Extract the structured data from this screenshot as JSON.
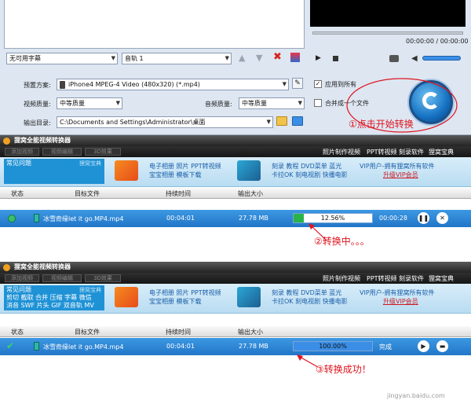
{
  "top_panel": {
    "subtitle_select": "无可用字幕",
    "audio_select": "音轨 1",
    "time_display": "00:00:00 / 00:00:00",
    "preset_label": "预置方案:",
    "preset_value": "iPhone4 MPEG-4 Video (480x320) (*.mp4)",
    "apply_all_label": "应用到所有",
    "apply_all_checked": true,
    "video_quality_label": "视频质量:",
    "video_quality_value": "中等质量",
    "audio_quality_label": "音频质量:",
    "audio_quality_value": "中等质量",
    "merge_label": "合并成一个文件",
    "merge_checked": false,
    "output_label": "输出目录:",
    "output_path": "C:\\Documents and Settings\\Administrator\\桌面",
    "annotation_1": "①点击开始转换"
  },
  "windows": [
    {
      "title": "狸窝全能视频转换器",
      "toolbar_buttons": [
        "添加视频",
        "视频编辑",
        "3D效果"
      ],
      "nav_links": [
        "照片制作视频",
        "PPT转视频",
        "刻录软件",
        "狸窝宝典"
      ],
      "faq_title": "常见问题",
      "faq_subtitle": "狸窝宝典",
      "faq_lines": [
        "",
        ""
      ],
      "ad_block_1": [
        "电子相册 照片 PPT转视频",
        "宝宝相册 模板下载"
      ],
      "ad_block_2": [
        "刻录 教程 DVD菜单 蓝光",
        "卡拉OK 刻电视剧 快播电影"
      ],
      "ad_block_3": [
        "VIP用户-拥有狸窝所有软件",
        "升级VIP会员"
      ],
      "headers": [
        "状态",
        "目标文件",
        "持续时间",
        "输出大小"
      ],
      "file_name": "冰雪奇缘let it go.MP4.mp4",
      "duration": "00:04:01",
      "size": "27.78 MB",
      "progress_text": "12.56%",
      "progress": 0.1256,
      "remaining": "00:00:28",
      "annotation": "②转换中。。。"
    },
    {
      "title": "狸窝全能视频转换器",
      "toolbar_buttons": [
        "添加视频",
        "视频编辑",
        "3D效果"
      ],
      "nav_links": [
        "照片制作视频",
        "PPT转视频",
        "刻录软件",
        "狸窝宝典"
      ],
      "faq_title": "常见问题",
      "faq_subtitle": "狸窝宝典",
      "faq_lines": [
        "剪切 截取 合并 压缩 字幕 微信",
        "消音 SWF 片头 GIF 双音轨 MV"
      ],
      "ad_block_1": [
        "电子相册 照片 PPT转视频",
        "宝宝相册 模板下载"
      ],
      "ad_block_2": [
        "刻录 教程 DVD菜单 蓝光",
        "卡拉OK 刻电视剧 快播电影"
      ],
      "ad_block_3": [
        "VIP用户-拥有狸窝所有软件",
        "升级VIP会员"
      ],
      "headers": [
        "状态",
        "目标文件",
        "持续时间",
        "输出大小"
      ],
      "file_name": "冰雪奇缘let it go.MP4.mp4",
      "duration": "00:04:01",
      "size": "27.78 MB",
      "progress_text": "100.00%",
      "progress": 1.0,
      "remaining": "完成",
      "annotation": "③转换成功！"
    }
  ],
  "watermark": "jingyan.baidu.com",
  "colors": {
    "accent_blue": "#2276c8",
    "annotation_red": "#e0141e",
    "progress_green": "#28b44a",
    "progress_blue": "#3a8ee6"
  }
}
